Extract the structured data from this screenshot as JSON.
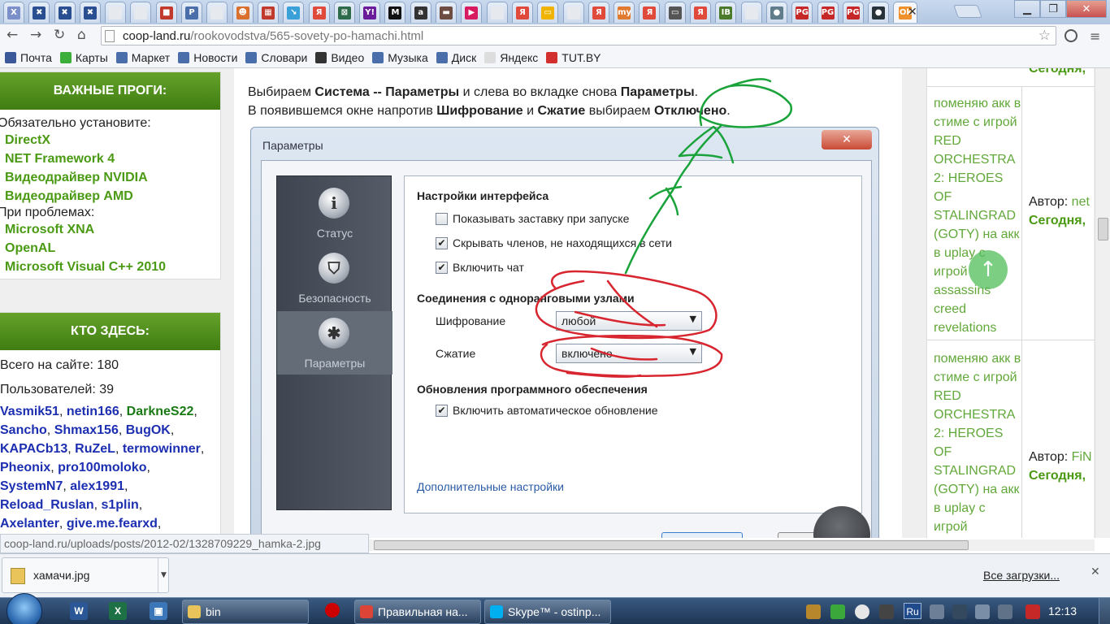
{
  "browser": {
    "tabs": [
      {
        "letter": "X",
        "color": "#7b8fc9"
      },
      {
        "letter": "✖",
        "color": "#2a4f90"
      },
      {
        "letter": "✖",
        "color": "#2a4f90"
      },
      {
        "letter": "✖",
        "color": "#2a4f90"
      },
      {
        "letter": "",
        "color": "#e6e9ee"
      },
      {
        "letter": "",
        "color": "#e6e9ee"
      },
      {
        "letter": "■",
        "color": "#c0392b"
      },
      {
        "letter": "P",
        "color": "#4a6ea9"
      },
      {
        "letter": "",
        "color": "#e6e9ee"
      },
      {
        "letter": "☻",
        "color": "#d9702e"
      },
      {
        "letter": "▦",
        "color": "#c0392b"
      },
      {
        "letter": "↘",
        "color": "#3aa0d8"
      },
      {
        "letter": "Я",
        "color": "#e04a3a"
      },
      {
        "letter": "⊠",
        "color": "#2e6b4a"
      },
      {
        "letter": "Y!",
        "color": "#6a1b9a"
      },
      {
        "letter": "M",
        "color": "#111111"
      },
      {
        "letter": "a",
        "color": "#333333"
      },
      {
        "letter": "▬",
        "color": "#6d4c41"
      },
      {
        "letter": "▶",
        "color": "#d81b60"
      },
      {
        "letter": "",
        "color": "#e6e9ee"
      },
      {
        "letter": "Я",
        "color": "#e04a3a"
      },
      {
        "letter": "▭",
        "color": "#f0b400"
      },
      {
        "letter": "",
        "color": "#e6e9ee"
      },
      {
        "letter": "Я",
        "color": "#e04a3a"
      },
      {
        "letter": "my",
        "color": "#e07a2e"
      },
      {
        "letter": "Я",
        "color": "#e04a3a"
      },
      {
        "letter": "▭",
        "color": "#555555"
      },
      {
        "letter": "Я",
        "color": "#e04a3a"
      },
      {
        "letter": "IB",
        "color": "#4a7a2a"
      },
      {
        "letter": "",
        "color": "#e6e9ee"
      },
      {
        "letter": "●",
        "color": "#607d8b"
      },
      {
        "letter": "PG",
        "color": "#c62828"
      },
      {
        "letter": "PG",
        "color": "#c62828"
      },
      {
        "letter": "PG",
        "color": "#c62828"
      },
      {
        "letter": "●",
        "color": "#263238"
      }
    ],
    "tab_extra": {
      "letter": "Ok",
      "color": "#f0902a"
    },
    "url_host": "coop-land.ru",
    "url_path": "/rookovodstva/565-sovety-po-hamachi.html",
    "bookmarks": [
      {
        "label": "Почта",
        "color": "#3b5998"
      },
      {
        "label": "Карты",
        "color": "#3cae3c"
      },
      {
        "label": "Маркет",
        "color": "#4a6ea9"
      },
      {
        "label": "Новости",
        "color": "#4a6ea9"
      },
      {
        "label": "Словари",
        "color": "#4a6ea9"
      },
      {
        "label": "Видео",
        "color": "#333333"
      },
      {
        "label": "Музыка",
        "color": "#4a6ea9"
      },
      {
        "label": "Диск",
        "color": "#4a6ea9"
      },
      {
        "label": "Яндекс",
        "color": "#dddddd"
      },
      {
        "label": "TUT.BY",
        "color": "#d32f2f"
      }
    ]
  },
  "sidebar": {
    "important": {
      "title": "ВАЖНЫЕ ПРОГИ:",
      "must_install": "Обязательно установите:",
      "must_links": [
        "DirectX",
        "NET Framework 4",
        "Видеодрайвер NVIDIA",
        "Видеодрайвер AMD"
      ],
      "problems": "При проблемах:",
      "problem_links": [
        "Microsoft XNA",
        "OpenAL",
        "Microsoft Visual C++ 2010"
      ]
    },
    "who": {
      "title": "КТО ЗДЕСЬ:",
      "total": "Всего на сайте: 180",
      "users": "Пользователей: 39",
      "lines": [
        [
          {
            "t": "Vasmik51",
            "c": "blue"
          },
          {
            "t": ", ",
            "c": "black"
          },
          {
            "t": "netin166",
            "c": "blue"
          },
          {
            "t": ", ",
            "c": "black"
          },
          {
            "t": "DarkneS22",
            "c": "green"
          },
          {
            "t": ",",
            "c": "black"
          }
        ],
        [
          {
            "t": "Sancho",
            "c": "blue"
          },
          {
            "t": ", ",
            "c": "black"
          },
          {
            "t": "Shmax156",
            "c": "blue"
          },
          {
            "t": ", ",
            "c": "black"
          },
          {
            "t": "BugOK",
            "c": "blue"
          },
          {
            "t": ",",
            "c": "black"
          }
        ],
        [
          {
            "t": "KAPACb13",
            "c": "blue"
          },
          {
            "t": ", ",
            "c": "black"
          },
          {
            "t": "RuZeL",
            "c": "blue"
          },
          {
            "t": ", ",
            "c": "black"
          },
          {
            "t": "termowinner",
            "c": "blue"
          },
          {
            "t": ",",
            "c": "black"
          }
        ],
        [
          {
            "t": "Pheonix",
            "c": "blue"
          },
          {
            "t": ", ",
            "c": "black"
          },
          {
            "t": "pro100moloko",
            "c": "blue"
          },
          {
            "t": ",",
            "c": "black"
          }
        ],
        [
          {
            "t": "SystemN7",
            "c": "blue"
          },
          {
            "t": ", ",
            "c": "black"
          },
          {
            "t": "alex1991",
            "c": "blue"
          },
          {
            "t": ",",
            "c": "black"
          }
        ],
        [
          {
            "t": "Reload_Ruslan",
            "c": "blue"
          },
          {
            "t": ", ",
            "c": "black"
          },
          {
            "t": "s1plin",
            "c": "blue"
          },
          {
            "t": ",",
            "c": "black"
          }
        ],
        [
          {
            "t": "Axelanter",
            "c": "blue"
          },
          {
            "t": ", ",
            "c": "black"
          },
          {
            "t": "give.me.fearxd",
            "c": "blue"
          },
          {
            "t": ",",
            "c": "black"
          }
        ]
      ]
    }
  },
  "article": {
    "line1": [
      {
        "t": "Выбираем ",
        "b": false
      },
      {
        "t": "Система -- Параметры",
        "b": true
      },
      {
        "t": " и слева во вкладке снова ",
        "b": false
      },
      {
        "t": "Параметры",
        "b": true
      },
      {
        "t": ".",
        "b": false
      }
    ],
    "line2": [
      {
        "t": "В появившемся окне напротив ",
        "b": false
      },
      {
        "t": "Шифрование",
        "b": true
      },
      {
        "t": " и ",
        "b": false
      },
      {
        "t": "Сжатие",
        "b": true
      },
      {
        "t": " выбираем ",
        "b": false
      },
      {
        "t": "Отключено",
        "b": true
      },
      {
        "t": ".",
        "b": false
      }
    ],
    "dialog": {
      "title": "Параметры",
      "close": "✕",
      "nav": [
        {
          "label": "Статус",
          "icon": "i",
          "selected": false
        },
        {
          "label": "Безопасность",
          "icon": "⛉",
          "selected": false
        },
        {
          "label": "Параметры",
          "icon": "✱",
          "selected": true
        }
      ],
      "group_interface": "Настройки интерфейса",
      "options": [
        {
          "label": "Показывать заставку при запуске",
          "checked": false
        },
        {
          "label": "Скрывать членов, не находящихся в сети",
          "checked": true
        },
        {
          "label": "Включить чат",
          "checked": true
        }
      ],
      "group_peers": "Соединения с одноранговыми узлами",
      "encryption_label": "Шифрование",
      "encryption_value": "любой",
      "compression_label": "Сжатие",
      "compression_value": "включено",
      "group_updates": "Обновления программного обеспечения",
      "auto_update": {
        "label": "Включить автоматическое обновление",
        "checked": true
      },
      "advanced_link": "Дополнительные настройки"
    },
    "annotation_colors": {
      "green": "#1aa33a",
      "red": "#d7262f"
    }
  },
  "comments": [
    {
      "message": "поменяю акк в стиме с игрой RED ORCHESTRA 2: HEROES OF STALINGRAD (GOTY) на акк в uplay с игрой assassins creed revelations",
      "author_label": "Автор:",
      "author": "net",
      "date": "Сегодня,"
    },
    {
      "message": "поменяю акк в стиме с игрой RED ORCHESTRA 2: HEROES OF STALINGRAD (GOTY) на акк в uplay с игрой",
      "author_label": "Автор:",
      "author": "FiN",
      "date": "Сегодня,"
    }
  ],
  "top_date": "Сегодня,",
  "status_url": "coop-land.ru/uploads/posts/2012-02/1328709229_hamka-2.jpg",
  "downloads": {
    "file": "хамачи.jpg",
    "all": "Все загрузки..."
  },
  "taskbar": {
    "tasks": [
      {
        "label": "bin",
        "color": "#e8c45a"
      },
      {
        "label": "Правильная на...",
        "color": "#db4437"
      },
      {
        "label": "Skype™ - ostinp...",
        "color": "#00aff0"
      }
    ],
    "lang": "Ru",
    "time": "12:13"
  }
}
